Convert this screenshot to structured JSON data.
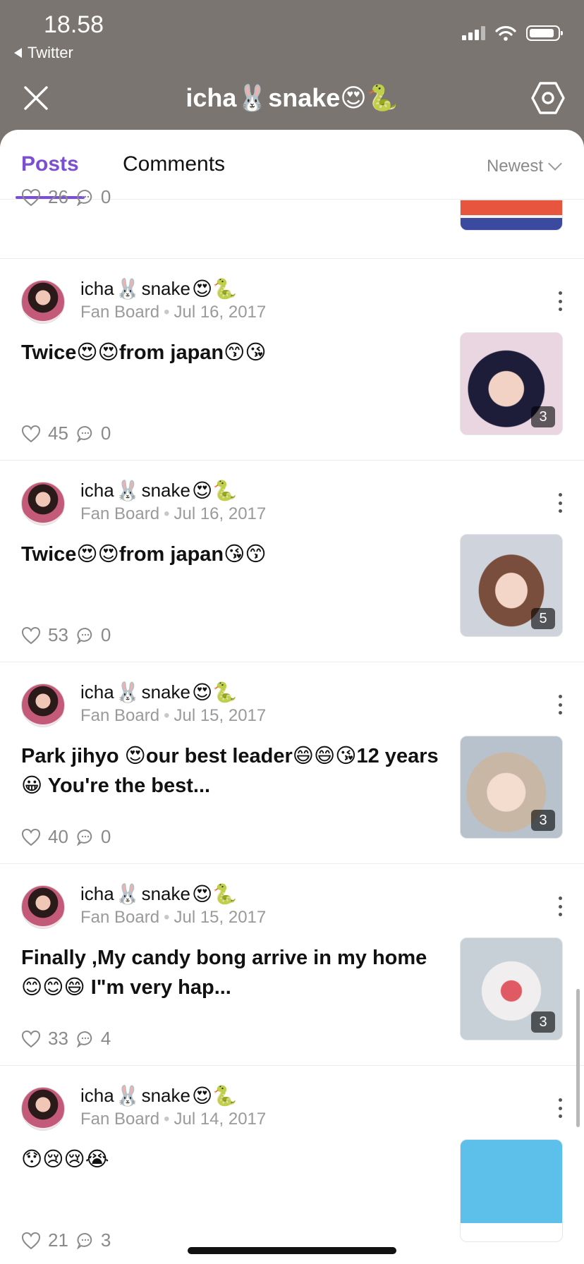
{
  "status": {
    "time": "18.58",
    "back_app": "Twitter"
  },
  "header": {
    "title": "icha🐰snake😍🐍"
  },
  "tabs": {
    "posts": "Posts",
    "comments": "Comments",
    "sort": "Newest"
  },
  "top_partial": {
    "likes": "26",
    "comments": "0"
  },
  "author": {
    "name": "icha",
    "rabbit": "🐰",
    "name2": "snake",
    "emojis": "😍🐍"
  },
  "posts": [
    {
      "board": "Fan Board",
      "date": "Jul 16, 2017",
      "text": "Twice😍😍from japan😙😘",
      "likes": "45",
      "comments": "0",
      "images": "3"
    },
    {
      "board": "Fan Board",
      "date": "Jul 16, 2017",
      "text": "Twice😍😍from japan😘😙",
      "likes": "53",
      "comments": "0",
      "images": "5"
    },
    {
      "board": "Fan Board",
      "date": "Jul 15, 2017",
      "text": "Park jihyo 😍our best leader😄😄😘12 years😀 You're the best...",
      "likes": "40",
      "comments": "0",
      "images": "3"
    },
    {
      "board": "Fan Board",
      "date": "Jul 15, 2017",
      "text": "Finally ,My candy bong arrive in my home 😊😊😄 I\"m very hap...",
      "likes": "33",
      "comments": "4",
      "images": "3"
    },
    {
      "board": "Fan Board",
      "date": "Jul 14, 2017",
      "text": "😯😢😢😭",
      "likes": "21",
      "comments": "3",
      "images": ""
    }
  ],
  "icons": {
    "close": "close-icon",
    "settings": "settings-icon",
    "heart": "heart-icon",
    "comment": "comment-icon",
    "more": "more-icon"
  },
  "colors": {
    "accent": "#7b4fd1",
    "header_bg": "#7a7570"
  }
}
